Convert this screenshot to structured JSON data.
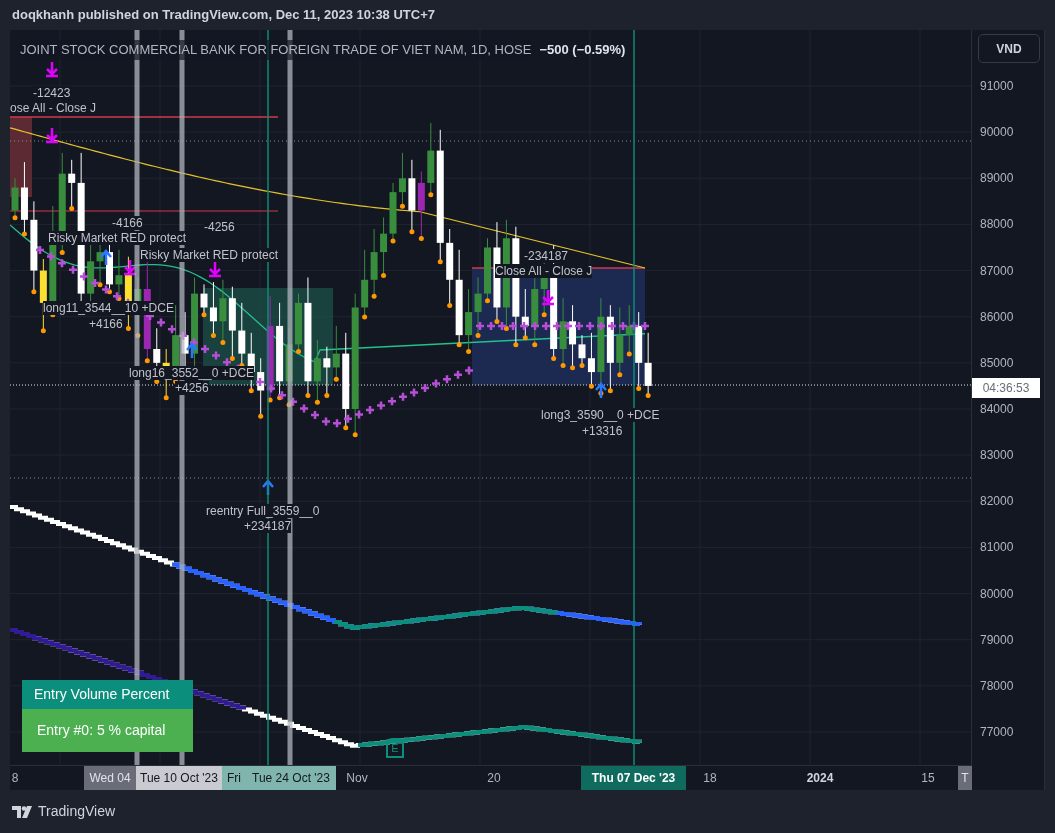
{
  "header": {
    "text": "doqkhanh published on TradingView.com, Dec 11, 2023 10:38 UTC+7"
  },
  "symbol": {
    "title": "JOINT STOCK COMMERCIAL BANK FOR FOREIGN TRADE OF VIET NAM, 1D, HOSE",
    "change": "−500 (−0.59%)"
  },
  "currency_button": "VND",
  "price_axis": [
    "91000",
    "90000",
    "89000",
    "88000",
    "87000",
    "86000",
    "85000",
    "84000",
    "83000",
    "82000",
    "81000",
    "80000",
    "79000",
    "78000",
    "77000"
  ],
  "countdown": "04:36:53",
  "annotations": [
    {
      "text": "-12423"
    },
    {
      "text": "ose All - Close J"
    },
    {
      "text": "-4166"
    },
    {
      "text": "Risky Market RED protect"
    },
    {
      "text": "-4256"
    },
    {
      "text": "Risky Market RED protect"
    },
    {
      "text": "long11_3544__10 +DCE"
    },
    {
      "text": "+4166"
    },
    {
      "text": "long16_3552__0 +DCE"
    },
    {
      "text": "+4256"
    },
    {
      "text": "reentry Full_3559__0"
    },
    {
      "text": "+234187"
    },
    {
      "text": "-234187"
    },
    {
      "text": "Close All - Close J"
    },
    {
      "text": "long3_3590__0 +DCE"
    },
    {
      "text": "+13316"
    }
  ],
  "legend": {
    "title": "Entry Volume Percent",
    "value": "Entry #0: 5 % capital"
  },
  "marker": "E",
  "time_axis": [
    {
      "label": "8",
      "kind": "plain"
    },
    {
      "label": "Wed 04",
      "kind": "grey"
    },
    {
      "label": "Tue 10 Oct '23",
      "kind": "light"
    },
    {
      "label": "Fri",
      "kind": "mint"
    },
    {
      "label": "Tue 24 Oct '23",
      "kind": "mint"
    },
    {
      "label": "Nov",
      "kind": "plain"
    },
    {
      "label": "20",
      "kind": "plain"
    },
    {
      "label": "Thu 07 Dec '23",
      "kind": "teal"
    },
    {
      "label": "18",
      "kind": "plain"
    },
    {
      "label": "2024",
      "kind": "bold"
    },
    {
      "label": "15",
      "kind": "plain"
    },
    {
      "label": "T",
      "kind": "grey"
    }
  ],
  "footer": {
    "brand": "TradingView"
  }
}
